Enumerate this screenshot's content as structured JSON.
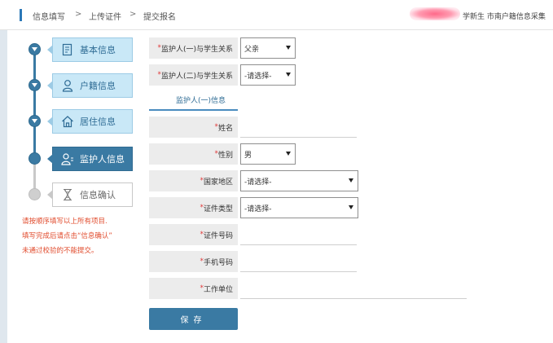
{
  "breadcrumb": [
    "信息填写",
    "上传证件",
    "提交报名"
  ],
  "breadcrumb_separator": ">",
  "header_user_text": "学新生 市南户籍信息采集",
  "steps": [
    {
      "label": "基本信息",
      "state": "done",
      "icon": "form-icon"
    },
    {
      "label": "户籍信息",
      "state": "done",
      "icon": "person-icon"
    },
    {
      "label": "居住信息",
      "state": "done",
      "icon": "home-icon"
    },
    {
      "label": "监护人信息",
      "state": "active",
      "icon": "guardian-icon"
    },
    {
      "label": "信息确认",
      "state": "pending",
      "icon": "hourglass-icon"
    }
  ],
  "notes": [
    "请按顺序填写以上所有项目.",
    "填写完成后请点击“信息确认”",
    "未通过校验的不能提交。"
  ],
  "form": {
    "guardian1_relation": {
      "label": "监护人(一)与学生关系",
      "value": "父亲"
    },
    "guardian2_relation": {
      "label": "监护人(二)与学生关系",
      "value": "-请选择-"
    },
    "tab_label": "监护人(一)信息",
    "name": {
      "label": "姓名",
      "value": ""
    },
    "gender": {
      "label": "性别",
      "value": "男"
    },
    "country": {
      "label": "国家地区",
      "value": "-请选择-"
    },
    "id_type": {
      "label": "证件类型",
      "value": "-请选择-"
    },
    "id_number": {
      "label": "证件号码",
      "value": ""
    },
    "phone": {
      "label": "手机号码",
      "value": ""
    },
    "workplace": {
      "label": "工作单位",
      "value": ""
    },
    "required_mark": "*"
  },
  "save_label": "保存",
  "colors": {
    "accent": "#3a7aa3",
    "step_done": "#c9e8f7",
    "required": "#e03b3b",
    "note": "#e14c2e"
  }
}
